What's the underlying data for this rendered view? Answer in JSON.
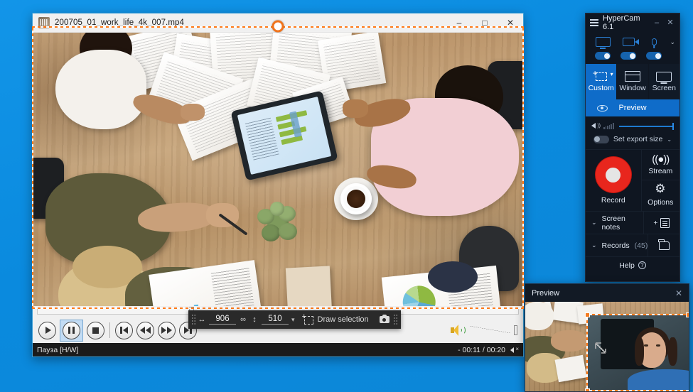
{
  "desktop": {
    "background_color": "#0b8ee3"
  },
  "player": {
    "title": "200705_01_work_life_4k_007.mp4",
    "icon": "video-file-icon",
    "window_controls": {
      "minimize": "–",
      "maximize": "□",
      "close": "✕"
    },
    "transport": [
      {
        "name": "play-button",
        "label": "Play",
        "state": "normal"
      },
      {
        "name": "pause-button",
        "label": "Pause",
        "state": "selected"
      },
      {
        "name": "stop-button",
        "label": "Stop",
        "state": "normal"
      },
      {
        "name": "previous-button",
        "label": "Previous",
        "state": "normal"
      },
      {
        "name": "rewind-button",
        "label": "Rewind",
        "state": "normal"
      },
      {
        "name": "fast-forward-button",
        "label": "Fast forward",
        "state": "normal"
      },
      {
        "name": "next-button",
        "label": "Next",
        "state": "normal"
      }
    ],
    "status_left": "Пауза [H/W]",
    "status_time": "- 00:11 / 00:20",
    "volume_icon": "speaker-icon",
    "mute_icon": "mute-icon"
  },
  "selection_toolbar": {
    "width_value": "906",
    "height_value": "510",
    "width_icon": "horizontal-arrows-icon",
    "link_icon": "link-icon",
    "height_icon": "vertical-arrows-icon",
    "dropdown_icon": "chevron-down-icon",
    "draw_selection_label": "Draw selection",
    "draw_selection_icon": "draw-selection-icon",
    "snapshot_icon": "camera-icon"
  },
  "hypercam": {
    "title": "HyperCam 6.1",
    "menu_icon": "hamburger-icon",
    "minimize": "–",
    "close": "✕",
    "sources": [
      {
        "name": "screen-source",
        "icon": "monitor-icon",
        "enabled": true
      },
      {
        "name": "camera-source",
        "icon": "camera-icon",
        "enabled": true
      },
      {
        "name": "microphone-source",
        "icon": "microphone-icon",
        "enabled": true
      }
    ],
    "sources_chevron": "⌄",
    "modes": [
      {
        "label": "Custom",
        "icon": "custom-region-icon",
        "active": true
      },
      {
        "label": "Window",
        "icon": "window-icon",
        "active": false
      },
      {
        "label": "Screen",
        "icon": "screen-icon",
        "active": false
      }
    ],
    "preview_label": "Preview",
    "preview_icon": "eye-icon",
    "volume_icon": "speaker-icon",
    "volume_level": 100,
    "export_size_label": "Set export size",
    "export_size_enabled": false,
    "export_chevron": "⌄",
    "record_label": "Record",
    "stream_label": "Stream",
    "stream_icon": "broadcast-icon",
    "options_label": "Options",
    "options_icon": "gear-icon",
    "screen_notes_label": "Screen notes",
    "screen_notes_chevron": "⌄",
    "add_note_plus": "+",
    "add_note_icon": "note-icon",
    "records_label": "Records",
    "records_count": "(45)",
    "records_chevron": "⌄",
    "records_folder_icon": "folder-icon",
    "help_label": "Help",
    "help_icon": "question-mark-icon",
    "accent_color": "#0f6cc9",
    "record_color": "#e8261d",
    "panel_color": "#0f1621"
  },
  "preview_window": {
    "title": "Preview",
    "close_icon": "✕",
    "overlay_handle_color": "#f47b20"
  }
}
